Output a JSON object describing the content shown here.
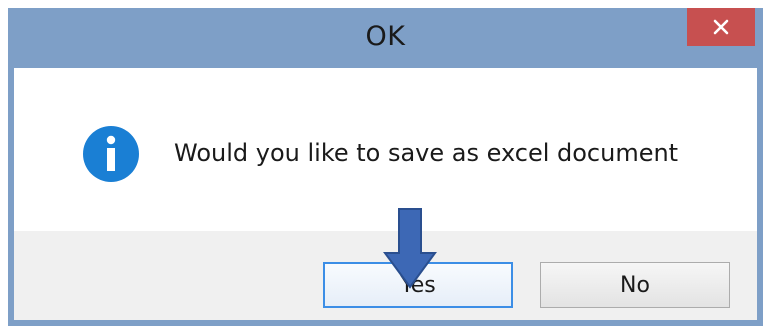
{
  "window": {
    "title": "OK"
  },
  "message": {
    "text": "Would you like to save as excel document",
    "icon": "info-icon"
  },
  "buttons": {
    "yes_label": "Yes",
    "no_label": "No"
  },
  "annotation": {
    "icon": "arrow-down-icon"
  },
  "colors": {
    "frame": "#7e9fc7",
    "close": "#c75050",
    "info_icon": "#1a7fd4",
    "arrow": "#3d68b5",
    "focus_border": "#3c8ee6"
  }
}
